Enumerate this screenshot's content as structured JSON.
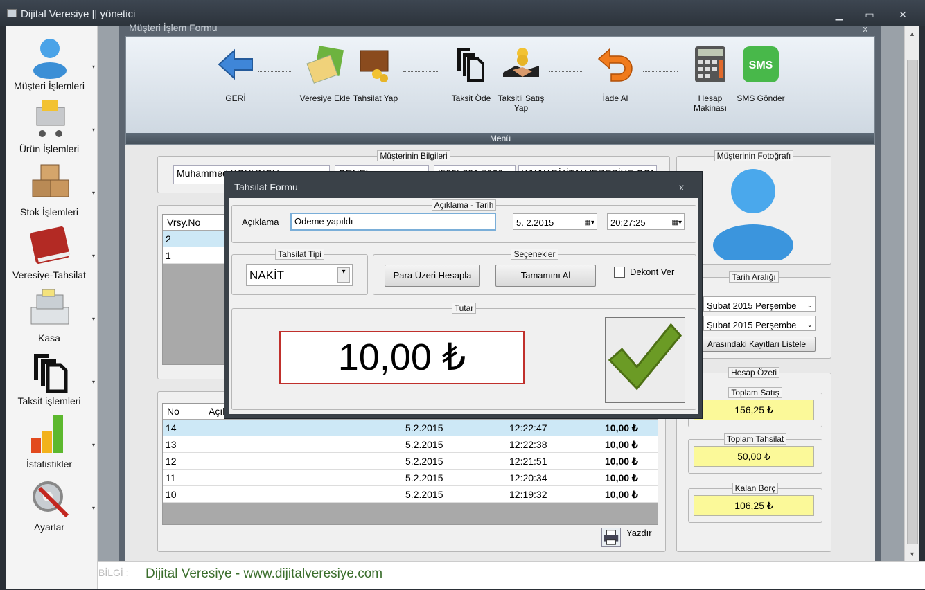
{
  "window": {
    "title": "Dijital Veresiye  ||  yönetici",
    "min": "▁",
    "max": "▭",
    "close": "✕"
  },
  "sidebar": {
    "items": [
      {
        "label": "Müşteri İşlemleri",
        "icon": "user-icon"
      },
      {
        "label": "Ürün İşlemleri",
        "icon": "cart-icon"
      },
      {
        "label": "Stok İşlemleri",
        "icon": "boxes-icon"
      },
      {
        "label": "Veresiye-Tahsilat",
        "icon": "ledger-book-icon"
      },
      {
        "label": "Kasa",
        "icon": "cash-register-icon"
      },
      {
        "label": "Taksit işlemleri",
        "icon": "copy-pages-icon"
      },
      {
        "label": "İstatistikler",
        "icon": "bar-chart-icon"
      },
      {
        "label": "Ayarlar",
        "icon": "gear-tools-icon"
      }
    ],
    "arrow": "▾"
  },
  "child": {
    "title": "Müşteri İşlem Formu",
    "close": "x"
  },
  "menu": {
    "bar_label": "Menü",
    "items": [
      {
        "label": "GERİ",
        "icon": "back-arrow-icon"
      },
      {
        "label": "Veresiye Ekle",
        "icon": "calculator-money-icon"
      },
      {
        "label": "Tahsilat Yap",
        "icon": "wallet-coins-icon"
      },
      {
        "label": "Taksit Öde",
        "icon": "copy-pages-icon"
      },
      {
        "label": "Taksitli Satış Yap",
        "icon": "handshake-coins-icon"
      },
      {
        "label": "İade Al",
        "icon": "return-arrow-icon"
      },
      {
        "label": "Hesap Makinası",
        "icon": "calculator-icon"
      },
      {
        "label": "SMS Gönder",
        "icon": "sms-icon"
      }
    ]
  },
  "customer_info": {
    "title": "Müşterinin Bilgileri",
    "name": "Muhammed KOYUNCU",
    "group": "GENEL",
    "phone": "(530) 391 7066",
    "web": "WWW.DİJİTALVERESİYE.COM"
  },
  "photo": {
    "title": "Müşterinin Fotoğrafı"
  },
  "upper_grid": {
    "header": "Vrsy.No",
    "rows": [
      "2",
      "1"
    ],
    "row1_extra": "i"
  },
  "lower_grid": {
    "headers": [
      "No",
      "Açıklama"
    ],
    "rows": [
      {
        "no": "14",
        "date": "5.2.2015",
        "time": "12:22:47",
        "amount": "10,00 ₺"
      },
      {
        "no": "13",
        "date": "5.2.2015",
        "time": "12:22:38",
        "amount": "10,00 ₺"
      },
      {
        "no": "12",
        "date": "5.2.2015",
        "time": "12:21:51",
        "amount": "10,00 ₺"
      },
      {
        "no": "11",
        "date": "5.2.2015",
        "time": "12:20:34",
        "amount": "10,00 ₺"
      },
      {
        "no": "10",
        "date": "5.2.2015",
        "time": "12:19:32",
        "amount": "10,00 ₺"
      }
    ],
    "print_label": "Yazdır"
  },
  "date_range": {
    "title": "Tarih Aralığı",
    "from": "Şubat  2015 Perşembe",
    "to": "Şubat  2015 Perşembe",
    "list_button": "Arasındaki Kayıtları Listele"
  },
  "summary": {
    "title": "Hesap Özeti",
    "total_sales_label": "Toplam Satış",
    "total_sales": "156,25 ₺",
    "total_collection_label": "Toplam Tahsilat",
    "total_collection": "50,00 ₺",
    "remaining_label": "Kalan Borç",
    "remaining": "106,25 ₺"
  },
  "dialog": {
    "title": "Tahsilat Formu",
    "close": "x",
    "desc_group": "Açıklama - Tarih",
    "desc_label": "Açıklama",
    "desc_value": "Ödeme yapıldı",
    "date": "5.  2.2015",
    "time": "20:27:25",
    "type_group": "Tahsilat Tipi",
    "type_value": "NAKİT",
    "options_group": "Seçenekler",
    "change_button": "Para Üzeri Hesapla",
    "all_button": "Tamamını Al",
    "receipt_label": "Dekont Ver",
    "amount_group": "Tutar",
    "amount": "10,00 ₺"
  },
  "status": {
    "info": "BİLGİ :",
    "text": "Dijital Veresiye - www.dijitalveresiye.com"
  }
}
